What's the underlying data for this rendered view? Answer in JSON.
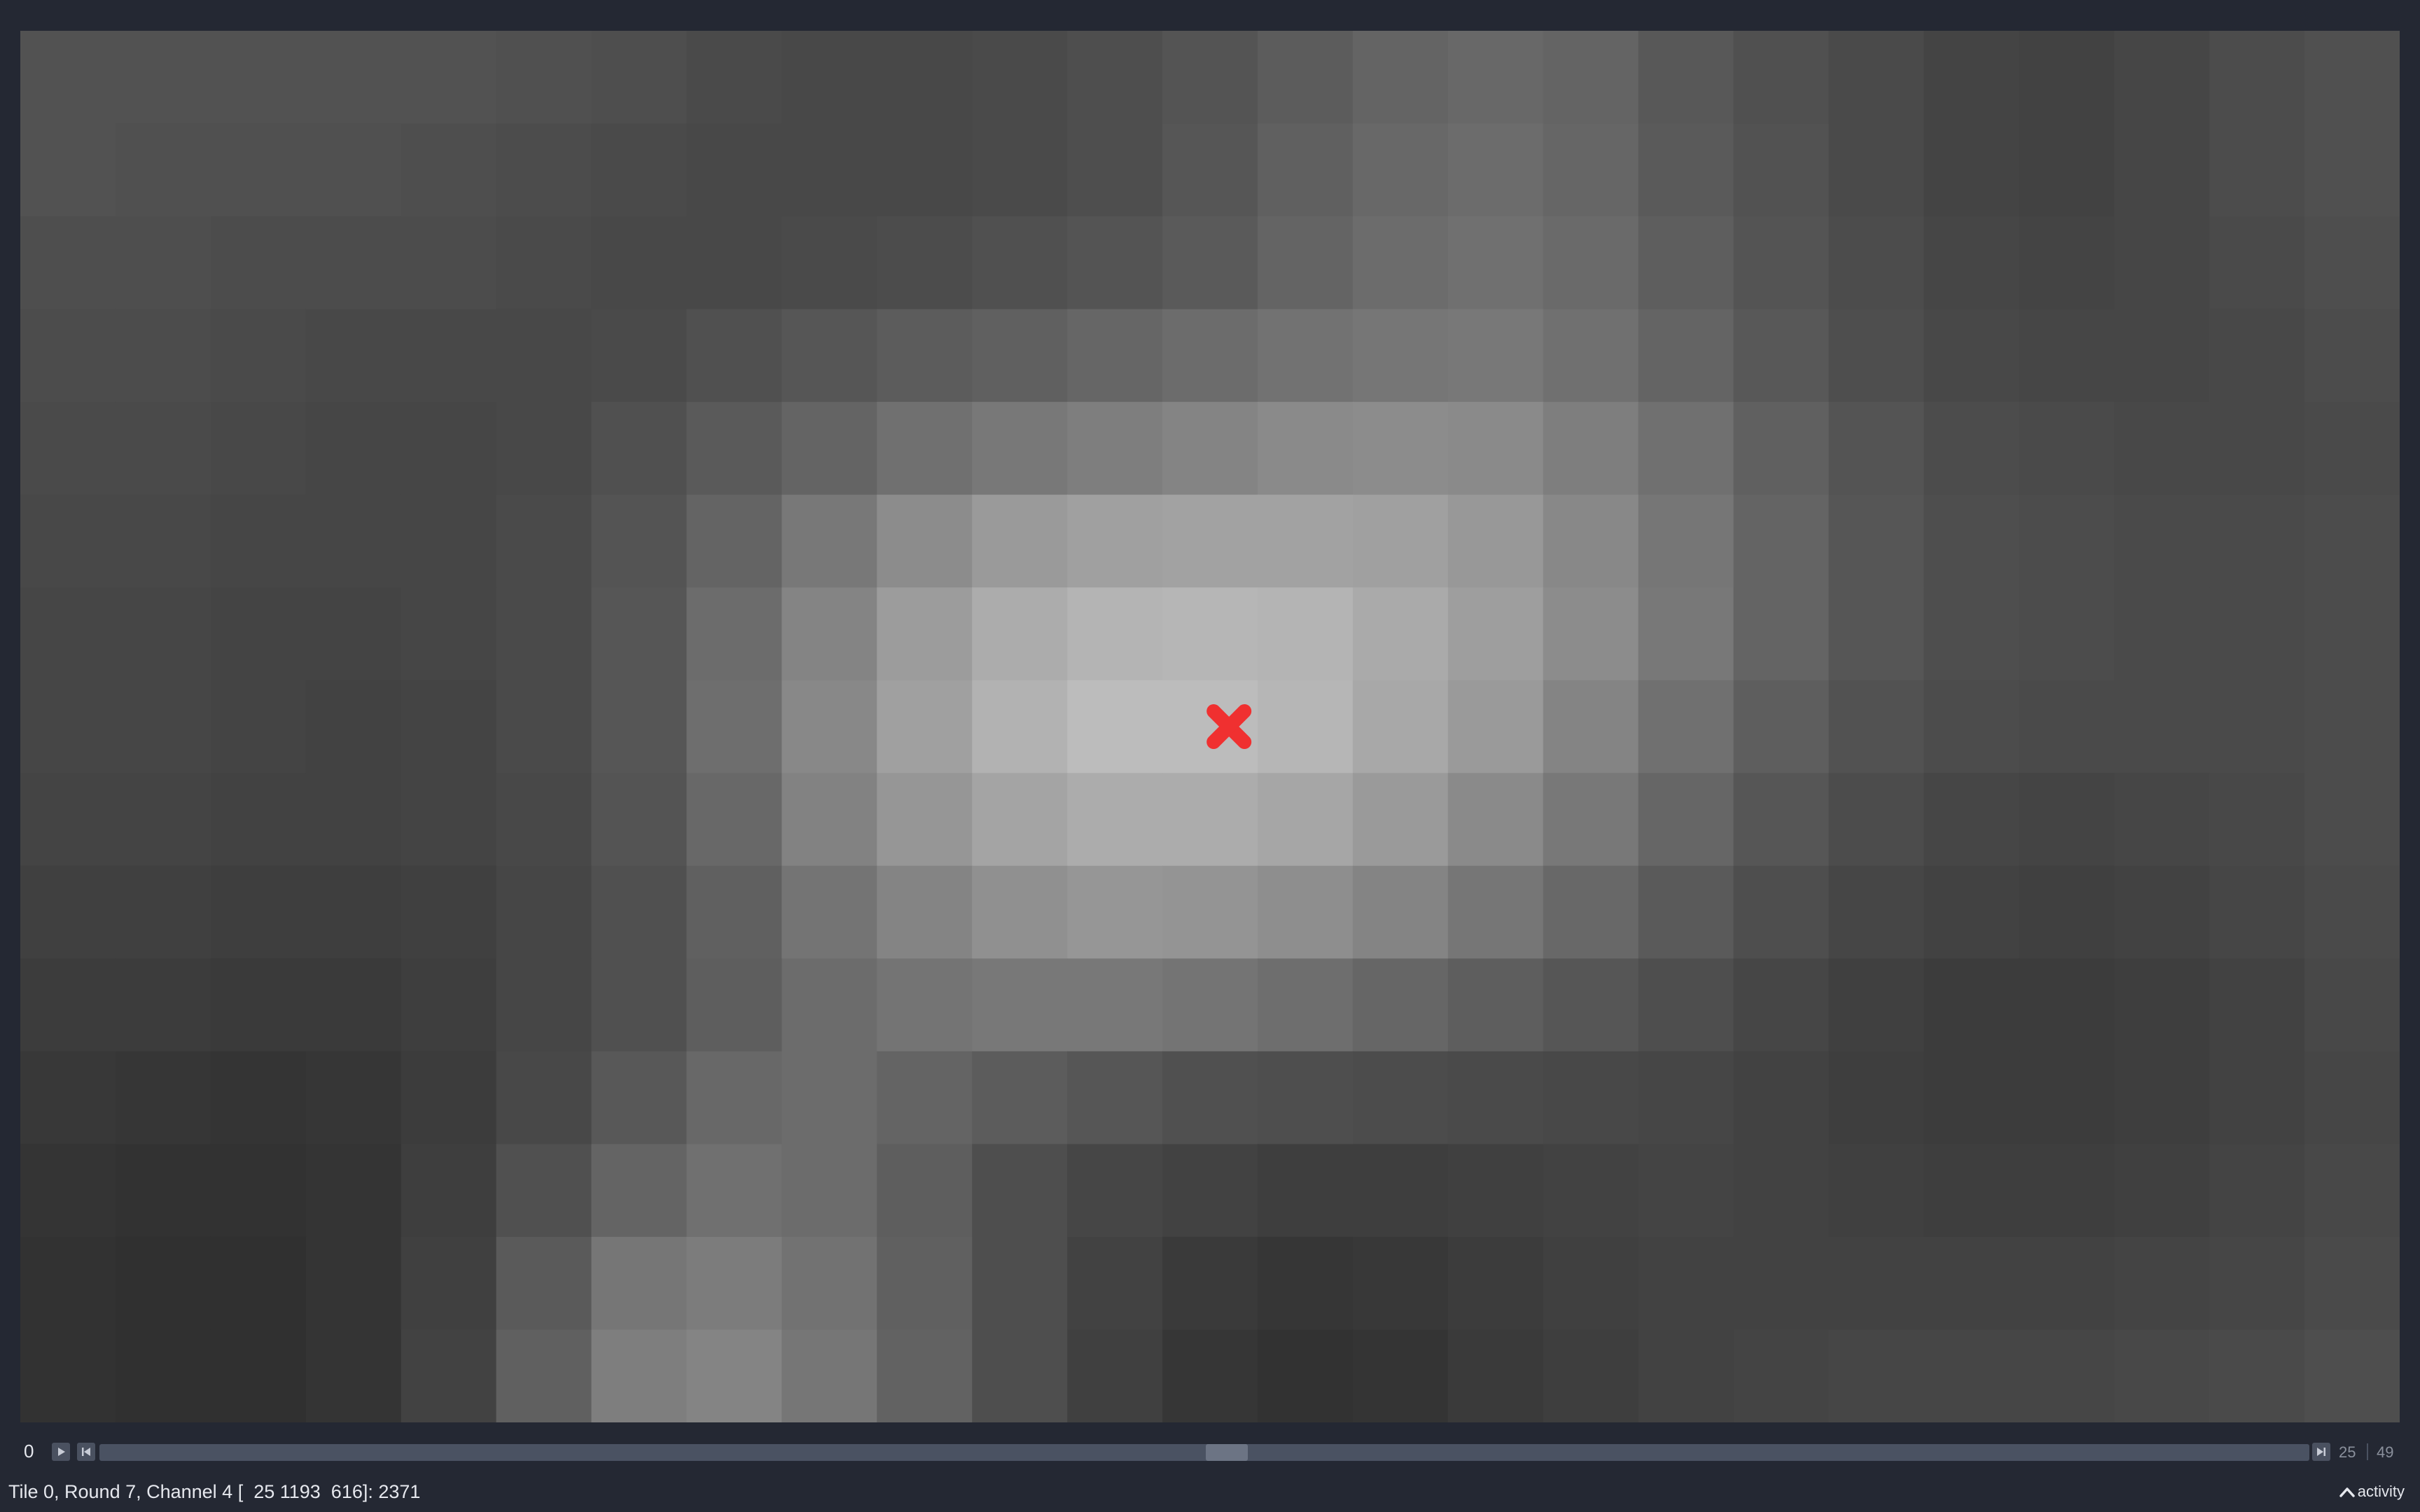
{
  "viewer": {
    "grid": {
      "rows": 15,
      "cols": 25,
      "values": [
        [
          82,
          82,
          82,
          82,
          82,
          80,
          78,
          74,
          72,
          72,
          74,
          78,
          84,
          92,
          100,
          104,
          100,
          88,
          80,
          74,
          68,
          66,
          70,
          76,
          80
        ],
        [
          82,
          80,
          80,
          80,
          78,
          76,
          74,
          72,
          72,
          72,
          74,
          78,
          86,
          96,
          104,
          108,
          102,
          90,
          82,
          74,
          68,
          66,
          70,
          76,
          80
        ],
        [
          78,
          78,
          76,
          76,
          76,
          74,
          72,
          72,
          74,
          76,
          80,
          84,
          90,
          100,
          108,
          112,
          106,
          94,
          84,
          76,
          70,
          68,
          70,
          74,
          78
        ],
        [
          76,
          76,
          74,
          72,
          72,
          72,
          74,
          80,
          86,
          92,
          96,
          102,
          108,
          114,
          118,
          120,
          112,
          100,
          88,
          78,
          72,
          70,
          70,
          72,
          76
        ],
        [
          74,
          74,
          72,
          70,
          70,
          72,
          80,
          90,
          100,
          112,
          120,
          126,
          132,
          138,
          140,
          138,
          126,
          112,
          96,
          84,
          76,
          74,
          72,
          72,
          74
        ],
        [
          72,
          72,
          70,
          70,
          70,
          74,
          84,
          100,
          120,
          140,
          154,
          160,
          162,
          162,
          160,
          152,
          136,
          118,
          100,
          86,
          78,
          76,
          74,
          74,
          76
        ],
        [
          70,
          70,
          68,
          68,
          70,
          74,
          86,
          108,
          132,
          156,
          172,
          180,
          182,
          180,
          170,
          158,
          140,
          120,
          100,
          86,
          78,
          76,
          74,
          74,
          76
        ],
        [
          70,
          70,
          68,
          66,
          68,
          74,
          86,
          110,
          136,
          160,
          178,
          188,
          188,
          182,
          168,
          154,
          132,
          112,
          94,
          82,
          76,
          74,
          74,
          74,
          76
        ],
        [
          68,
          68,
          66,
          66,
          68,
          72,
          84,
          104,
          130,
          150,
          164,
          172,
          172,
          166,
          154,
          138,
          120,
          102,
          86,
          76,
          70,
          68,
          70,
          72,
          76
        ],
        [
          64,
          64,
          62,
          62,
          64,
          70,
          80,
          96,
          116,
          132,
          144,
          150,
          148,
          142,
          132,
          118,
          104,
          90,
          78,
          70,
          66,
          64,
          66,
          70,
          74
        ],
        [
          60,
          60,
          58,
          58,
          62,
          70,
          80,
          94,
          108,
          116,
          120,
          120,
          116,
          110,
          102,
          94,
          86,
          78,
          70,
          64,
          60,
          60,
          62,
          66,
          72
        ],
        [
          56,
          54,
          52,
          54,
          60,
          72,
          88,
          104,
          108,
          100,
          92,
          86,
          80,
          78,
          76,
          74,
          72,
          70,
          66,
          62,
          60,
          60,
          62,
          66,
          70
        ],
        [
          52,
          50,
          50,
          52,
          62,
          80,
          100,
          112,
          108,
          94,
          78,
          70,
          66,
          62,
          62,
          64,
          66,
          68,
          66,
          64,
          62,
          62,
          64,
          68,
          72
        ],
        [
          50,
          48,
          48,
          52,
          64,
          90,
          118,
          124,
          114,
          96,
          78,
          66,
          58,
          54,
          56,
          60,
          64,
          66,
          66,
          66,
          66,
          66,
          68,
          70,
          74
        ],
        [
          50,
          48,
          48,
          52,
          66,
          96,
          126,
          132,
          118,
          98,
          78,
          64,
          54,
          50,
          52,
          58,
          62,
          66,
          68,
          70,
          70,
          70,
          72,
          74,
          78
        ]
      ]
    },
    "marker": {
      "row": 7,
      "col": 12.7,
      "color": "#f03030",
      "icon": "x-marker-icon"
    }
  },
  "controls": {
    "frame_start": "0",
    "frame_current": "25",
    "frame_end": "49",
    "play_icon": "play-icon",
    "skip_start_icon": "skip-to-start-icon",
    "skip_end_icon": "skip-to-end-icon",
    "slider_value": 25,
    "slider_min": 0,
    "slider_max": 49
  },
  "status": {
    "text": "Tile 0, Round 7, Channel 4 [  25 1193  616]: 2371"
  },
  "activity": {
    "label": "activity",
    "icon": "chevron-up-icon"
  }
}
